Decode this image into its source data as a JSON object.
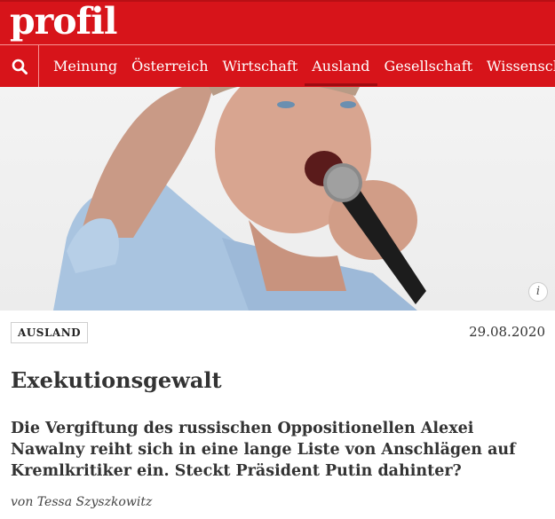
{
  "header": {
    "logo": "profil",
    "nav": [
      "Meinung",
      "Österreich",
      "Wirtschaft",
      "Ausland",
      "Gesellschaft",
      "Wissenschaft"
    ],
    "active_nav": "Ausland"
  },
  "hero": {
    "info_label": "i"
  },
  "article": {
    "category": "AUSLAND",
    "date": "29.08.2020",
    "title": "Exekutionsgewalt",
    "lead": "Die Vergiftung des russischen Oppositionellen Alexei Nawalny reiht sich in eine lange Liste von Anschlägen auf Kremlkritiker ein. Steckt Präsident Putin dahinter?",
    "author": "von Tessa Szyszkowitz"
  },
  "colors": {
    "brand_red": "#d7141a",
    "active_underline": "#9e0c11"
  }
}
